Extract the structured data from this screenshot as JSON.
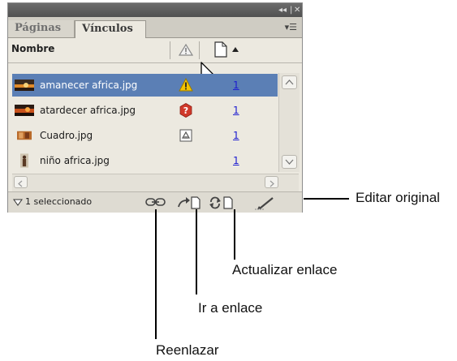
{
  "panel": {
    "tabs": [
      {
        "label": "Páginas"
      },
      {
        "label": "Vínculos"
      }
    ],
    "column_header": {
      "name": "Nombre"
    },
    "rows": [
      {
        "name": "amanecer africa.jpg",
        "page": "1",
        "status_icon": "warning-icon",
        "selected": true
      },
      {
        "name": "atardecer africa.jpg",
        "page": "1",
        "status_icon": "missing-link-icon",
        "selected": false
      },
      {
        "name": "Cuadro.jpg",
        "page": "1",
        "status_icon": "embedded-icon",
        "selected": false
      },
      {
        "name": "niño africa.jpg",
        "page": "1",
        "status_icon": "",
        "selected": false
      }
    ],
    "status_bar": {
      "selection_text": "1 seleccionado"
    }
  },
  "callouts": {
    "editar_original": "Editar original",
    "actualizar_enlace": "Actualizar enlace",
    "ir_a_enlace": "Ir a enlace",
    "reenlazar": "Reenlazar"
  },
  "colors": {
    "selection": "#5b7fb5",
    "panel_bg": "#ece9e0",
    "titlebar": "#505050",
    "link_blue": "#1d1dd0",
    "warning": "#f4c400",
    "missing": "#d0392a"
  }
}
